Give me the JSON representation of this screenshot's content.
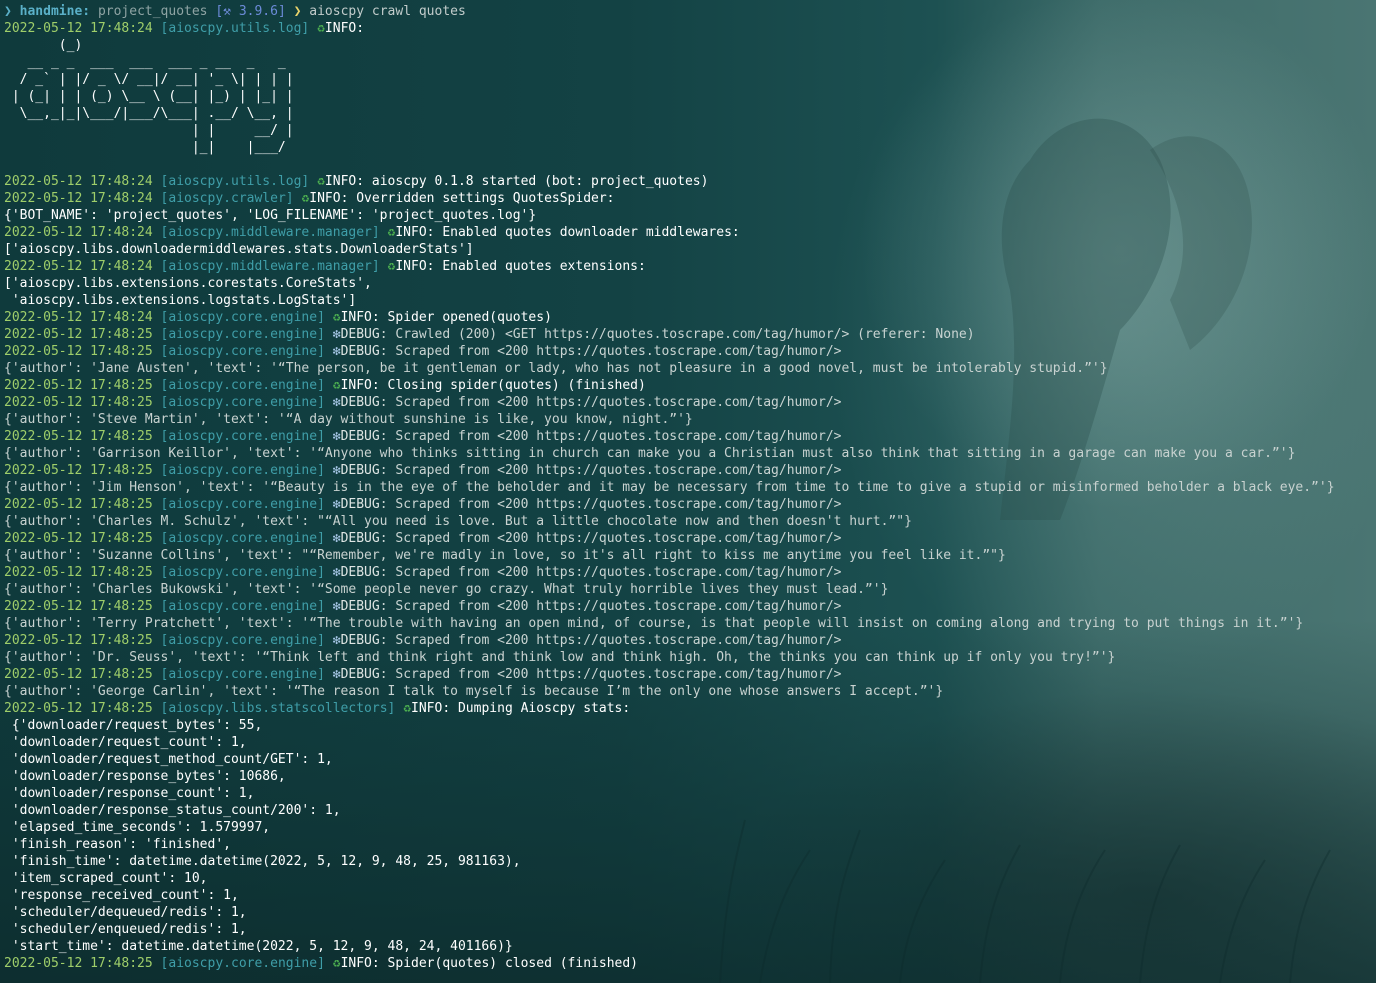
{
  "prompt": {
    "icon": "❯",
    "host": "handmine:",
    "dir": "project_quotes",
    "env": "[⚒ 3.9.6]",
    "arrow": "❯",
    "command": "aioscpy crawl quotes"
  },
  "colors": {
    "timestamp": "#9fce6a",
    "module": "#3f9ea8",
    "info_icon": "#4caf50",
    "debug_icon": "#a7c7e7"
  },
  "banner": [
    "       (_)",
    "   __ _ _  ___  ___  ___ _ __  _   _",
    "  / _` | |/ _ \\/ __|/ __| '_ \\| | | |",
    " | (_| | | (_) \\__ \\ (__| |_) | |_| |",
    "  \\__,_|_|\\___/|___/\\___| .__/ \\__, |",
    "                        | |     __/ |",
    "                        |_|    |___/"
  ],
  "log": [
    {
      "ts": "2022-05-12 17:48:24",
      "mod": "[aioscpy.utils.log]",
      "level": "INFO:",
      "msg": ""
    },
    {
      "banner": true
    },
    {
      "blank": true
    },
    {
      "ts": "2022-05-12 17:48:24",
      "mod": "[aioscpy.utils.log]",
      "level": "INFO",
      "msg": ": aioscpy 0.1.8 started (bot: project_quotes)"
    },
    {
      "ts": "2022-05-12 17:48:24",
      "mod": "[aioscpy.crawler]",
      "level": "INFO",
      "msg": ": Overridden settings QuotesSpider:"
    },
    {
      "text": "{'BOT_NAME': 'project_quotes', 'LOG_FILENAME': 'project_quotes.log'}",
      "cls": "plain"
    },
    {
      "ts": "2022-05-12 17:48:24",
      "mod": "[aioscpy.middleware.manager]",
      "level": "INFO",
      "msg": ": Enabled quotes downloader middlewares:"
    },
    {
      "text": "['aioscpy.libs.downloadermiddlewares.stats.DownloaderStats']",
      "cls": "plain"
    },
    {
      "ts": "2022-05-12 17:48:24",
      "mod": "[aioscpy.middleware.manager]",
      "level": "INFO",
      "msg": ": Enabled quotes extensions:"
    },
    {
      "text": "['aioscpy.libs.extensions.corestats.CoreStats',",
      "cls": "plain"
    },
    {
      "text": " 'aioscpy.libs.extensions.logstats.LogStats']",
      "cls": "plain"
    },
    {
      "ts": "2022-05-12 17:48:24",
      "mod": "[aioscpy.core.engine]",
      "level": "INFO",
      "msg": ": Spider opened(quotes)"
    },
    {
      "ts": "2022-05-12 17:48:25",
      "mod": "[aioscpy.core.engine]",
      "level": "DEBUG",
      "msg": ": Crawled (200) <GET https://quotes.toscrape.com/tag/humor/> (referer: None)"
    },
    {
      "ts": "2022-05-12 17:48:25",
      "mod": "[aioscpy.core.engine]",
      "level": "DEBUG",
      "msg": ": Scraped from <200 https://quotes.toscrape.com/tag/humor/>"
    },
    {
      "text": "{'author': 'Jane Austen', 'text': '“The person, be it gentleman or lady, who has not pleasure in a good novel, must be intolerably stupid.”'}",
      "cls": "dict"
    },
    {
      "ts": "2022-05-12 17:48:25",
      "mod": "[aioscpy.core.engine]",
      "level": "INFO",
      "msg": ": Closing spider(quotes) (finished)"
    },
    {
      "ts": "2022-05-12 17:48:25",
      "mod": "[aioscpy.core.engine]",
      "level": "DEBUG",
      "msg": ": Scraped from <200 https://quotes.toscrape.com/tag/humor/>"
    },
    {
      "text": "{'author': 'Steve Martin', 'text': '“A day without sunshine is like, you know, night.”'}",
      "cls": "dict"
    },
    {
      "ts": "2022-05-12 17:48:25",
      "mod": "[aioscpy.core.engine]",
      "level": "DEBUG",
      "msg": ": Scraped from <200 https://quotes.toscrape.com/tag/humor/>"
    },
    {
      "text": "{'author': 'Garrison Keillor', 'text': '“Anyone who thinks sitting in church can make you a Christian must also think that sitting in a garage can make you a car.”'}",
      "cls": "dict"
    },
    {
      "ts": "2022-05-12 17:48:25",
      "mod": "[aioscpy.core.engine]",
      "level": "DEBUG",
      "msg": ": Scraped from <200 https://quotes.toscrape.com/tag/humor/>"
    },
    {
      "text": "{'author': 'Jim Henson', 'text': '“Beauty is in the eye of the beholder and it may be necessary from time to time to give a stupid or misinformed beholder a black eye.”'}",
      "cls": "dict"
    },
    {
      "ts": "2022-05-12 17:48:25",
      "mod": "[aioscpy.core.engine]",
      "level": "DEBUG",
      "msg": ": Scraped from <200 https://quotes.toscrape.com/tag/humor/>"
    },
    {
      "text": "{'author': 'Charles M. Schulz', 'text': \"“All you need is love. But a little chocolate now and then doesn't hurt.”\"}",
      "cls": "dict"
    },
    {
      "ts": "2022-05-12 17:48:25",
      "mod": "[aioscpy.core.engine]",
      "level": "DEBUG",
      "msg": ": Scraped from <200 https://quotes.toscrape.com/tag/humor/>"
    },
    {
      "text": "{'author': 'Suzanne Collins', 'text': \"“Remember, we're madly in love, so it's all right to kiss me anytime you feel like it.”\"}",
      "cls": "dict"
    },
    {
      "ts": "2022-05-12 17:48:25",
      "mod": "[aioscpy.core.engine]",
      "level": "DEBUG",
      "msg": ": Scraped from <200 https://quotes.toscrape.com/tag/humor/>"
    },
    {
      "text": "{'author': 'Charles Bukowski', 'text': '“Some people never go crazy. What truly horrible lives they must lead.”'}",
      "cls": "dict"
    },
    {
      "ts": "2022-05-12 17:48:25",
      "mod": "[aioscpy.core.engine]",
      "level": "DEBUG",
      "msg": ": Scraped from <200 https://quotes.toscrape.com/tag/humor/>"
    },
    {
      "text": "{'author': 'Terry Pratchett', 'text': '“The trouble with having an open mind, of course, is that people will insist on coming along and trying to put things in it.”'}",
      "cls": "dict"
    },
    {
      "ts": "2022-05-12 17:48:25",
      "mod": "[aioscpy.core.engine]",
      "level": "DEBUG",
      "msg": ": Scraped from <200 https://quotes.toscrape.com/tag/humor/>"
    },
    {
      "text": "{'author': 'Dr. Seuss', 'text': '“Think left and think right and think low and think high. Oh, the thinks you can think up if only you try!”'}",
      "cls": "dict"
    },
    {
      "ts": "2022-05-12 17:48:25",
      "mod": "[aioscpy.core.engine]",
      "level": "DEBUG",
      "msg": ": Scraped from <200 https://quotes.toscrape.com/tag/humor/>"
    },
    {
      "text": "{'author': 'George Carlin', 'text': '“The reason I talk to myself is because I’m the only one whose answers I accept.”'}",
      "cls": "dict"
    },
    {
      "ts": "2022-05-12 17:48:25",
      "mod": "[aioscpy.libs.statscollectors]",
      "level": "INFO",
      "msg": ": Dumping Aioscpy stats:"
    },
    {
      "text": " {'downloader/request_bytes': 55,",
      "cls": "plain"
    },
    {
      "text": " 'downloader/request_count': 1,",
      "cls": "plain"
    },
    {
      "text": " 'downloader/request_method_count/GET': 1,",
      "cls": "plain"
    },
    {
      "text": " 'downloader/response_bytes': 10686,",
      "cls": "plain"
    },
    {
      "text": " 'downloader/response_count': 1,",
      "cls": "plain"
    },
    {
      "text": " 'downloader/response_status_count/200': 1,",
      "cls": "plain"
    },
    {
      "text": " 'elapsed_time_seconds': 1.579997,",
      "cls": "plain"
    },
    {
      "text": " 'finish_reason': 'finished',",
      "cls": "plain"
    },
    {
      "text": " 'finish_time': datetime.datetime(2022, 5, 12, 9, 48, 25, 981163),",
      "cls": "plain"
    },
    {
      "text": " 'item_scraped_count': 10,",
      "cls": "plain"
    },
    {
      "text": " 'response_received_count': 1,",
      "cls": "plain"
    },
    {
      "text": " 'scheduler/dequeued/redis': 1,",
      "cls": "plain"
    },
    {
      "text": " 'scheduler/enqueued/redis': 1,",
      "cls": "plain"
    },
    {
      "text": " 'start_time': datetime.datetime(2022, 5, 12, 9, 48, 24, 401166)}",
      "cls": "plain"
    },
    {
      "ts": "2022-05-12 17:48:25",
      "mod": "[aioscpy.core.engine]",
      "level": "INFO",
      "msg": ": Spider(quotes) closed (finished)"
    }
  ]
}
